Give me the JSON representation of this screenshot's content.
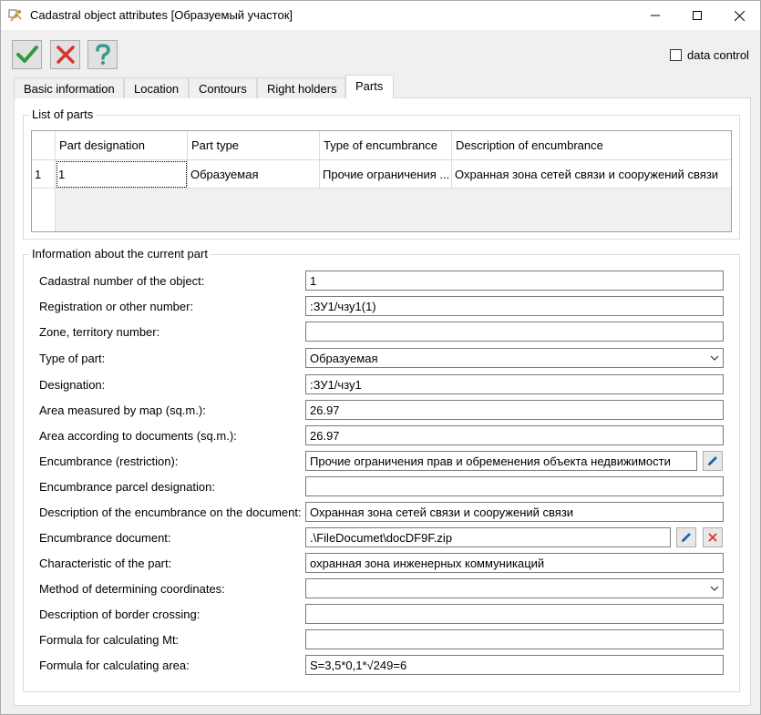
{
  "window": {
    "title": "Cadastral object attributes [Образуемый участок]"
  },
  "toolbar": {
    "data_control_label": "data control"
  },
  "tabs": [
    "Basic information",
    "Location",
    "Contours",
    "Right holders",
    "Parts"
  ],
  "list_of_parts": {
    "legend": "List of parts",
    "columns": [
      "Part designation",
      "Part type",
      "Type of encumbrance",
      "Description of encumbrance"
    ],
    "rows": [
      {
        "index": "1",
        "cells": [
          "1",
          "Образуемая",
          "Прочие ограничения ...",
          "Охранная зона сетей связи и сооружений связи"
        ]
      }
    ]
  },
  "current_part": {
    "legend": "Information about the current part",
    "labels": {
      "cadastral_number": "Cadastral number of the object:",
      "registration_number": "Registration or other number:",
      "zone_number": "Zone, territory number:",
      "type_of_part": "Type of part:",
      "designation": "Designation:",
      "area_map": "Area measured by map (sq.m.):",
      "area_docs": "Area according to documents (sq.m.):",
      "encumbrance": "Encumbrance (restriction):",
      "encumbrance_parcel": "Encumbrance parcel designation:",
      "encumbrance_description": "Description of the encumbrance on the document:",
      "encumbrance_document": "Encumbrance document:",
      "characteristic": "Characteristic of the part:",
      "method_coordinates": "Method of determining coordinates:",
      "border_crossing": "Description of border crossing:",
      "formula_mt": "Formula for calculating Mt:",
      "formula_area": "Formula for calculating area:"
    },
    "values": {
      "cadastral_number": "1",
      "registration_number": ":ЗУ1/чзу1(1)",
      "zone_number": "",
      "type_of_part": "Образуемая",
      "designation": ":ЗУ1/чзу1",
      "area_map": "26.97",
      "area_docs": "26.97",
      "encumbrance": "Прочие ограничения прав и обременения объекта недвижимости",
      "encumbrance_parcel": "",
      "encumbrance_description": "Охранная зона сетей связи и сооружений связи",
      "encumbrance_document": ".\\FileDocumet\\docDF9F.zip",
      "characteristic": "охранная зона инженерных коммуникаций",
      "method_coordinates": "",
      "border_crossing": "",
      "formula_mt": "",
      "formula_area": "S=3,5*0,1*√249=6"
    }
  },
  "colors": {
    "ok": "#2e9a3e",
    "cancel": "#d9342b",
    "help": "#3a9a8f",
    "edit": "#1e64b4"
  }
}
